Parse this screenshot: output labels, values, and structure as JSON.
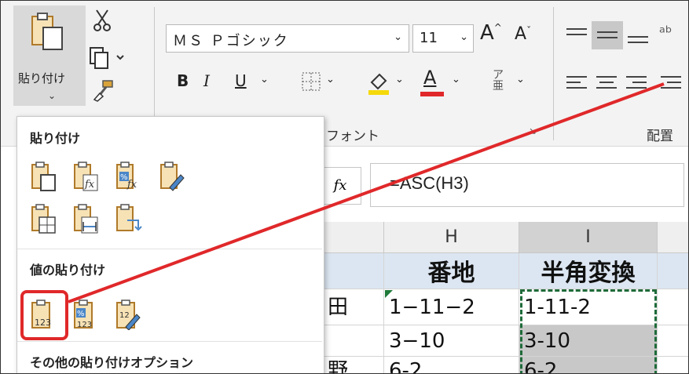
{
  "ribbon": {
    "paste_label": "貼り付け",
    "paste_chevron": "⌄",
    "font_name": "ＭＳ Ｐゴシック",
    "font_size": "11",
    "font_group_label": "フォント",
    "alignment_group_label": "配置",
    "bold": "B",
    "italic": "I",
    "underline": "U",
    "grow_font": "A",
    "shrink_font": "A",
    "font_color_letter": "A",
    "font_color": "#e0282a",
    "fill_color": "#f5d90a"
  },
  "formula_bar": {
    "fx_label": "fx",
    "formula": "=ASC(H3)"
  },
  "columns": [
    {
      "label": "H",
      "selected": false
    },
    {
      "label": "I",
      "selected": true
    }
  ],
  "rows": {
    "header": {
      "left_clip": "",
      "h": "番地",
      "i": "半角変換"
    },
    "r1": {
      "left_clip": "田",
      "h": "1−11−2",
      "i": "1-11-2"
    },
    "r2": {
      "left_clip": "",
      "h": "3−10",
      "i": "3-10"
    },
    "r3": {
      "left_clip": "野",
      "h": "6-2",
      "i": "6-2"
    }
  },
  "paste_menu": {
    "section1": "貼り付け",
    "section2": "値の貼り付け",
    "section3": "その他の貼り付けオプション",
    "icons_row1": [
      "paste-icon",
      "paste-formulas-icon",
      "paste-formulas-number-format-icon",
      "paste-keep-source-format-icon"
    ],
    "icons_row2": [
      "paste-no-borders-icon",
      "paste-keep-column-widths-icon",
      "paste-transpose-icon"
    ],
    "icons_values": [
      "paste-values-icon",
      "paste-values-number-format-icon",
      "paste-values-source-format-icon"
    ],
    "values_label": "123"
  },
  "accent_color": "#e0282a"
}
